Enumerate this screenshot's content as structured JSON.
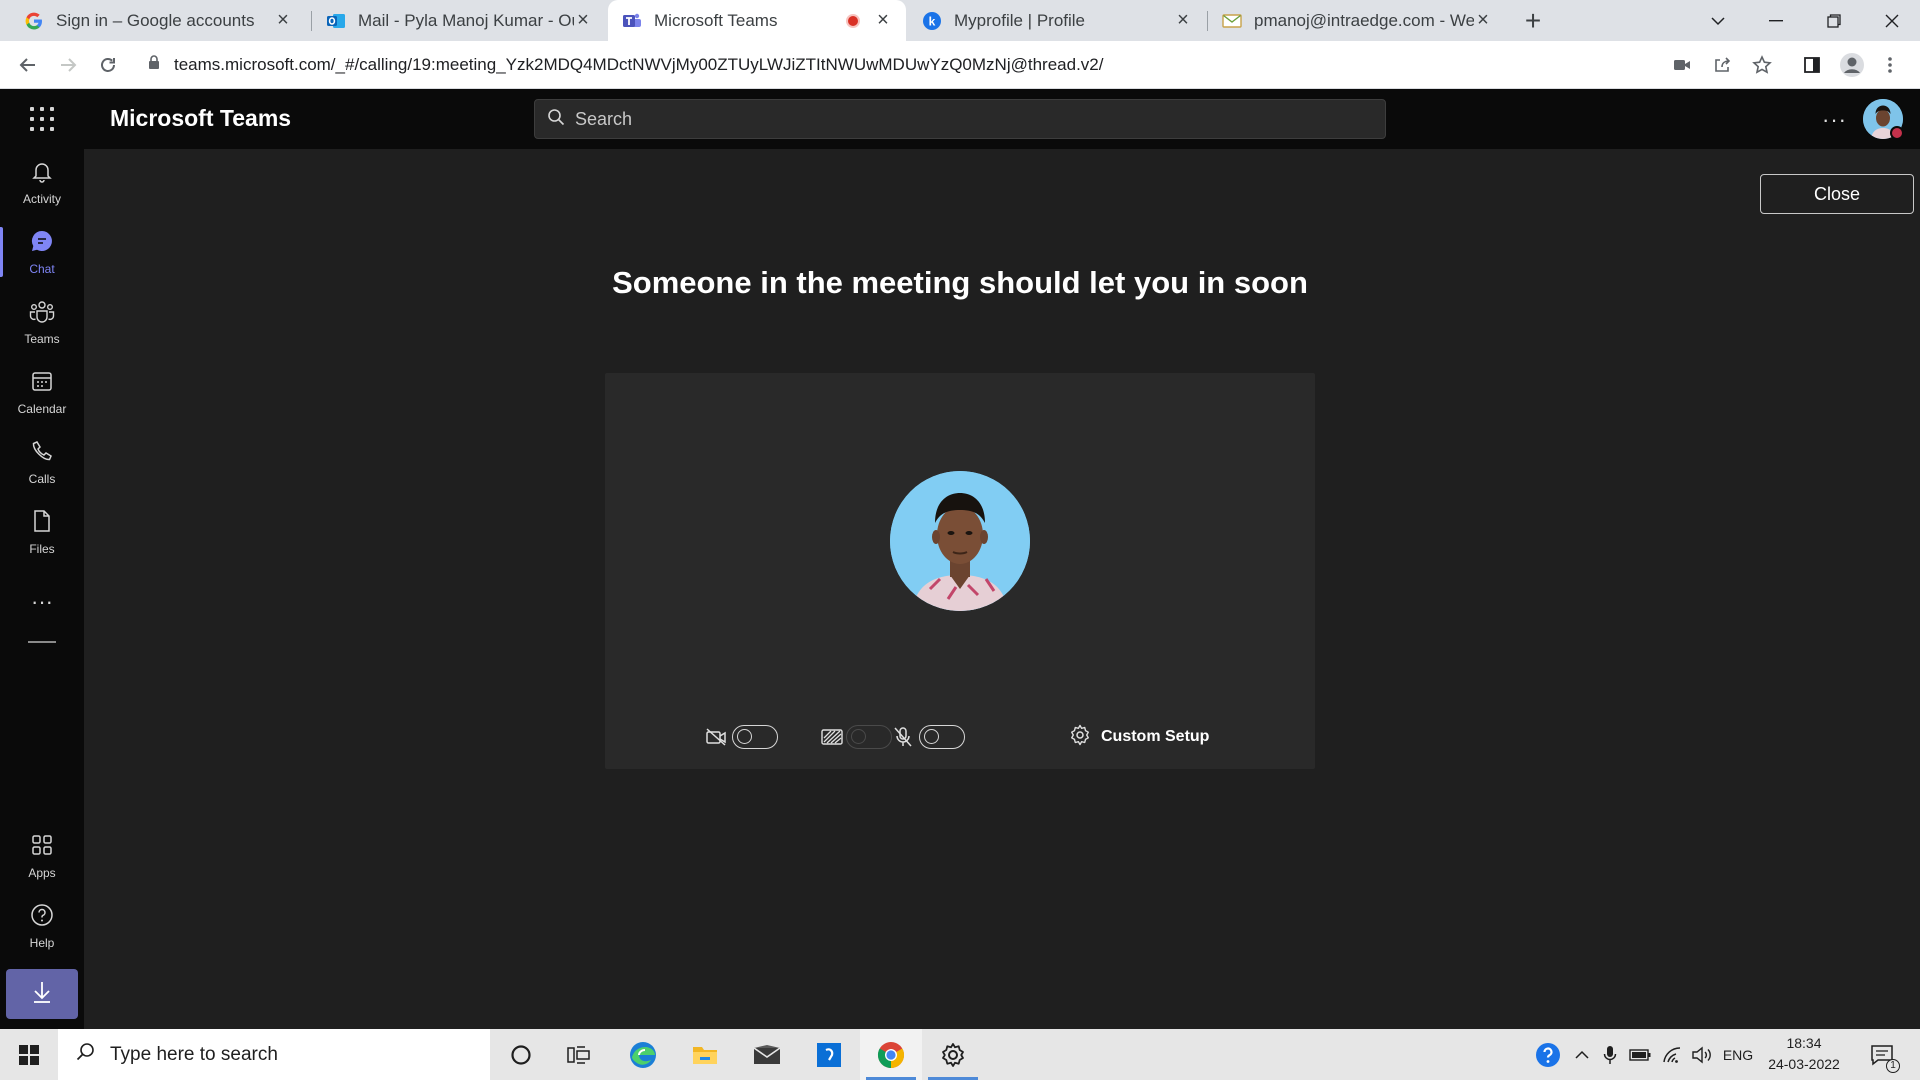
{
  "browser": {
    "tabs": [
      {
        "title": "Sign in – Google accounts",
        "icon": "google-g-icon"
      },
      {
        "title": "Mail - Pyla Manoj Kumar - Outlook",
        "icon": "outlook-icon"
      },
      {
        "title": "Microsoft Teams",
        "icon": "teams-icon",
        "active": true,
        "recording": true
      },
      {
        "title": "Myprofile | Profile",
        "icon": "k-icon"
      },
      {
        "title": "pmanoj@intraedge.com - Webmail",
        "icon": "mail-envelope-icon"
      }
    ],
    "url": "teams.microsoft.com/_#/calling/19:meeting_Yzk2MDQ4MDctNWVjMy00ZTUyLWJiZTItNWUwMDUwYzQ0MzNj@thread.v2/"
  },
  "teams": {
    "app_title": "Microsoft Teams",
    "search_placeholder": "Search",
    "more_label": "···",
    "rail": [
      {
        "label": "Activity",
        "icon": "bell-icon"
      },
      {
        "label": "Chat",
        "icon": "chat-icon",
        "active": true
      },
      {
        "label": "Teams",
        "icon": "teams-people-icon"
      },
      {
        "label": "Calendar",
        "icon": "calendar-icon"
      },
      {
        "label": "Calls",
        "icon": "phone-icon"
      },
      {
        "label": "Files",
        "icon": "file-icon"
      }
    ],
    "rail_more": "···",
    "rail_bottom": [
      {
        "label": "Apps",
        "icon": "apps-icon"
      },
      {
        "label": "Help",
        "icon": "help-icon"
      }
    ],
    "main": {
      "close_label": "Close",
      "lobby_message": "Someone in the meeting should let you in soon",
      "controls": {
        "camera_on": false,
        "background_blur_enabled": false,
        "mic_on": false,
        "custom_setup_label": "Custom Setup"
      }
    }
  },
  "taskbar": {
    "search_placeholder": "Type here to search",
    "language": "ENG",
    "time": "18:34",
    "date": "24-03-2022",
    "notification_count": "1"
  },
  "colors": {
    "accent": "#7f85f5",
    "teams_purple": "#6264a7",
    "recording_red": "#d93025",
    "presence_busy": "#c4314b"
  }
}
